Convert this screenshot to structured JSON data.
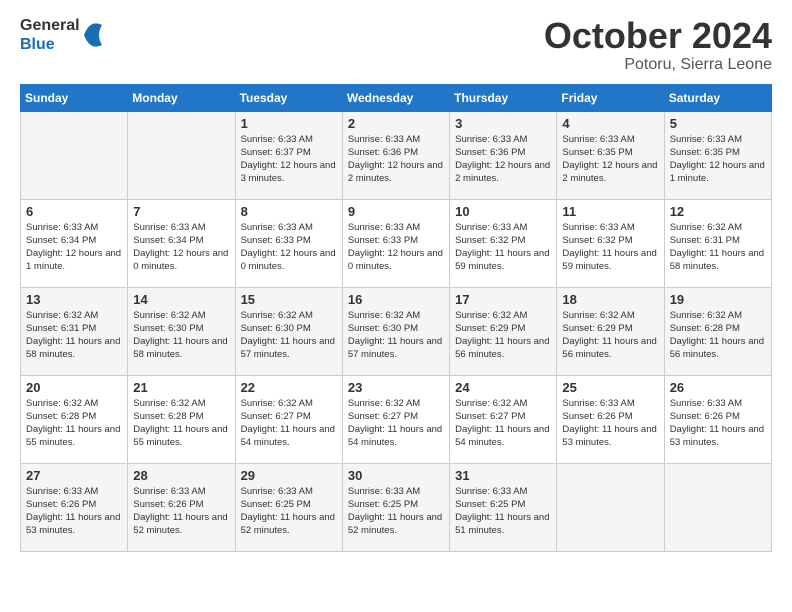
{
  "header": {
    "logo_line1": "General",
    "logo_line2": "Blue",
    "month": "October 2024",
    "location": "Potoru, Sierra Leone"
  },
  "days_of_week": [
    "Sunday",
    "Monday",
    "Tuesday",
    "Wednesday",
    "Thursday",
    "Friday",
    "Saturday"
  ],
  "weeks": [
    [
      {
        "day": "",
        "info": ""
      },
      {
        "day": "",
        "info": ""
      },
      {
        "day": "1",
        "sunrise": "Sunrise: 6:33 AM",
        "sunset": "Sunset: 6:37 PM",
        "daylight": "Daylight: 12 hours and 3 minutes."
      },
      {
        "day": "2",
        "sunrise": "Sunrise: 6:33 AM",
        "sunset": "Sunset: 6:36 PM",
        "daylight": "Daylight: 12 hours and 2 minutes."
      },
      {
        "day": "3",
        "sunrise": "Sunrise: 6:33 AM",
        "sunset": "Sunset: 6:36 PM",
        "daylight": "Daylight: 12 hours and 2 minutes."
      },
      {
        "day": "4",
        "sunrise": "Sunrise: 6:33 AM",
        "sunset": "Sunset: 6:35 PM",
        "daylight": "Daylight: 12 hours and 2 minutes."
      },
      {
        "day": "5",
        "sunrise": "Sunrise: 6:33 AM",
        "sunset": "Sunset: 6:35 PM",
        "daylight": "Daylight: 12 hours and 1 minute."
      }
    ],
    [
      {
        "day": "6",
        "sunrise": "Sunrise: 6:33 AM",
        "sunset": "Sunset: 6:34 PM",
        "daylight": "Daylight: 12 hours and 1 minute."
      },
      {
        "day": "7",
        "sunrise": "Sunrise: 6:33 AM",
        "sunset": "Sunset: 6:34 PM",
        "daylight": "Daylight: 12 hours and 0 minutes."
      },
      {
        "day": "8",
        "sunrise": "Sunrise: 6:33 AM",
        "sunset": "Sunset: 6:33 PM",
        "daylight": "Daylight: 12 hours and 0 minutes."
      },
      {
        "day": "9",
        "sunrise": "Sunrise: 6:33 AM",
        "sunset": "Sunset: 6:33 PM",
        "daylight": "Daylight: 12 hours and 0 minutes."
      },
      {
        "day": "10",
        "sunrise": "Sunrise: 6:33 AM",
        "sunset": "Sunset: 6:32 PM",
        "daylight": "Daylight: 11 hours and 59 minutes."
      },
      {
        "day": "11",
        "sunrise": "Sunrise: 6:33 AM",
        "sunset": "Sunset: 6:32 PM",
        "daylight": "Daylight: 11 hours and 59 minutes."
      },
      {
        "day": "12",
        "sunrise": "Sunrise: 6:32 AM",
        "sunset": "Sunset: 6:31 PM",
        "daylight": "Daylight: 11 hours and 58 minutes."
      }
    ],
    [
      {
        "day": "13",
        "sunrise": "Sunrise: 6:32 AM",
        "sunset": "Sunset: 6:31 PM",
        "daylight": "Daylight: 11 hours and 58 minutes."
      },
      {
        "day": "14",
        "sunrise": "Sunrise: 6:32 AM",
        "sunset": "Sunset: 6:30 PM",
        "daylight": "Daylight: 11 hours and 58 minutes."
      },
      {
        "day": "15",
        "sunrise": "Sunrise: 6:32 AM",
        "sunset": "Sunset: 6:30 PM",
        "daylight": "Daylight: 11 hours and 57 minutes."
      },
      {
        "day": "16",
        "sunrise": "Sunrise: 6:32 AM",
        "sunset": "Sunset: 6:30 PM",
        "daylight": "Daylight: 11 hours and 57 minutes."
      },
      {
        "day": "17",
        "sunrise": "Sunrise: 6:32 AM",
        "sunset": "Sunset: 6:29 PM",
        "daylight": "Daylight: 11 hours and 56 minutes."
      },
      {
        "day": "18",
        "sunrise": "Sunrise: 6:32 AM",
        "sunset": "Sunset: 6:29 PM",
        "daylight": "Daylight: 11 hours and 56 minutes."
      },
      {
        "day": "19",
        "sunrise": "Sunrise: 6:32 AM",
        "sunset": "Sunset: 6:28 PM",
        "daylight": "Daylight: 11 hours and 56 minutes."
      }
    ],
    [
      {
        "day": "20",
        "sunrise": "Sunrise: 6:32 AM",
        "sunset": "Sunset: 6:28 PM",
        "daylight": "Daylight: 11 hours and 55 minutes."
      },
      {
        "day": "21",
        "sunrise": "Sunrise: 6:32 AM",
        "sunset": "Sunset: 6:28 PM",
        "daylight": "Daylight: 11 hours and 55 minutes."
      },
      {
        "day": "22",
        "sunrise": "Sunrise: 6:32 AM",
        "sunset": "Sunset: 6:27 PM",
        "daylight": "Daylight: 11 hours and 54 minutes."
      },
      {
        "day": "23",
        "sunrise": "Sunrise: 6:32 AM",
        "sunset": "Sunset: 6:27 PM",
        "daylight": "Daylight: 11 hours and 54 minutes."
      },
      {
        "day": "24",
        "sunrise": "Sunrise: 6:32 AM",
        "sunset": "Sunset: 6:27 PM",
        "daylight": "Daylight: 11 hours and 54 minutes."
      },
      {
        "day": "25",
        "sunrise": "Sunrise: 6:33 AM",
        "sunset": "Sunset: 6:26 PM",
        "daylight": "Daylight: 11 hours and 53 minutes."
      },
      {
        "day": "26",
        "sunrise": "Sunrise: 6:33 AM",
        "sunset": "Sunset: 6:26 PM",
        "daylight": "Daylight: 11 hours and 53 minutes."
      }
    ],
    [
      {
        "day": "27",
        "sunrise": "Sunrise: 6:33 AM",
        "sunset": "Sunset: 6:26 PM",
        "daylight": "Daylight: 11 hours and 53 minutes."
      },
      {
        "day": "28",
        "sunrise": "Sunrise: 6:33 AM",
        "sunset": "Sunset: 6:26 PM",
        "daylight": "Daylight: 11 hours and 52 minutes."
      },
      {
        "day": "29",
        "sunrise": "Sunrise: 6:33 AM",
        "sunset": "Sunset: 6:25 PM",
        "daylight": "Daylight: 11 hours and 52 minutes."
      },
      {
        "day": "30",
        "sunrise": "Sunrise: 6:33 AM",
        "sunset": "Sunset: 6:25 PM",
        "daylight": "Daylight: 11 hours and 52 minutes."
      },
      {
        "day": "31",
        "sunrise": "Sunrise: 6:33 AM",
        "sunset": "Sunset: 6:25 PM",
        "daylight": "Daylight: 11 hours and 51 minutes."
      },
      {
        "day": "",
        "info": ""
      },
      {
        "day": "",
        "info": ""
      }
    ]
  ]
}
